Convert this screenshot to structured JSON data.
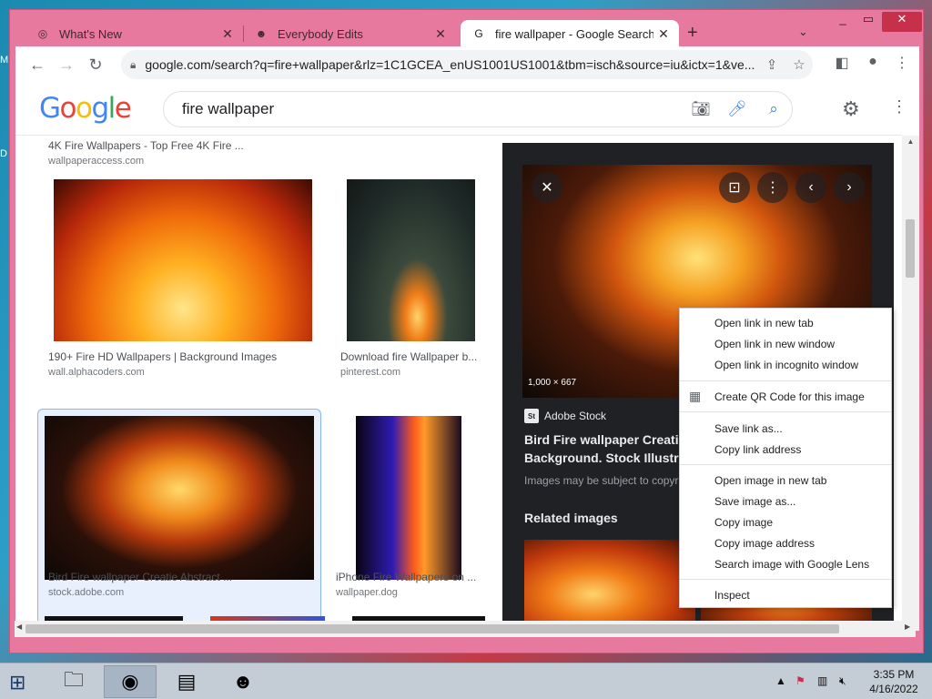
{
  "browser": {
    "tabs": [
      {
        "title": "What's New",
        "active": false
      },
      {
        "title": "Everybody Edits",
        "active": false
      },
      {
        "title": "fire wallpaper - Google Search",
        "active": true
      }
    ],
    "url": "google.com/search?q=fire+wallpaper&rlz=1C1GCEA_enUS1001US1001&tbm=isch&source=iu&ictx=1&ve..."
  },
  "google": {
    "logo": {
      "l1": "G",
      "l2": "o",
      "l3": "o",
      "l4": "g",
      "l5": "l",
      "l6": "e"
    },
    "query": "fire wallpaper"
  },
  "results": [
    {
      "title": "4K Fire Wallpapers - Top Free 4K Fire ...",
      "site": "wallpaperaccess.com"
    },
    {
      "title": "190+ Fire HD Wallpapers | Background Images",
      "site": "wall.alphacoders.com"
    },
    {
      "title": "Download fire Wallpaper b...",
      "site": "pinterest.com"
    },
    {
      "title": "Bird Fire wallpaper Creatie Abstract ...",
      "site": "stock.adobe.com"
    },
    {
      "title": "iPhone Fire Wallpapers on ...",
      "site": "wallpaper.dog"
    }
  ],
  "preview": {
    "size": "1,000 × 667",
    "source": "Adobe Stock",
    "source_badge": "St",
    "title": "Bird Fire wallpaper Creatie Background. Stock Illustrat",
    "note": "Images may be subject to copyri",
    "related": "Related images"
  },
  "context_menu": {
    "items": [
      "Open link in new tab",
      "Open link in new window",
      "Open link in incognito window",
      "Create QR Code for this image",
      "Save link as...",
      "Copy link address",
      "Open image in new tab",
      "Save image as...",
      "Copy image",
      "Copy image address",
      "Search image with Google Lens",
      "Inspect"
    ]
  },
  "taskbar": {
    "time": "3:35 PM",
    "date": "4/16/2022"
  }
}
